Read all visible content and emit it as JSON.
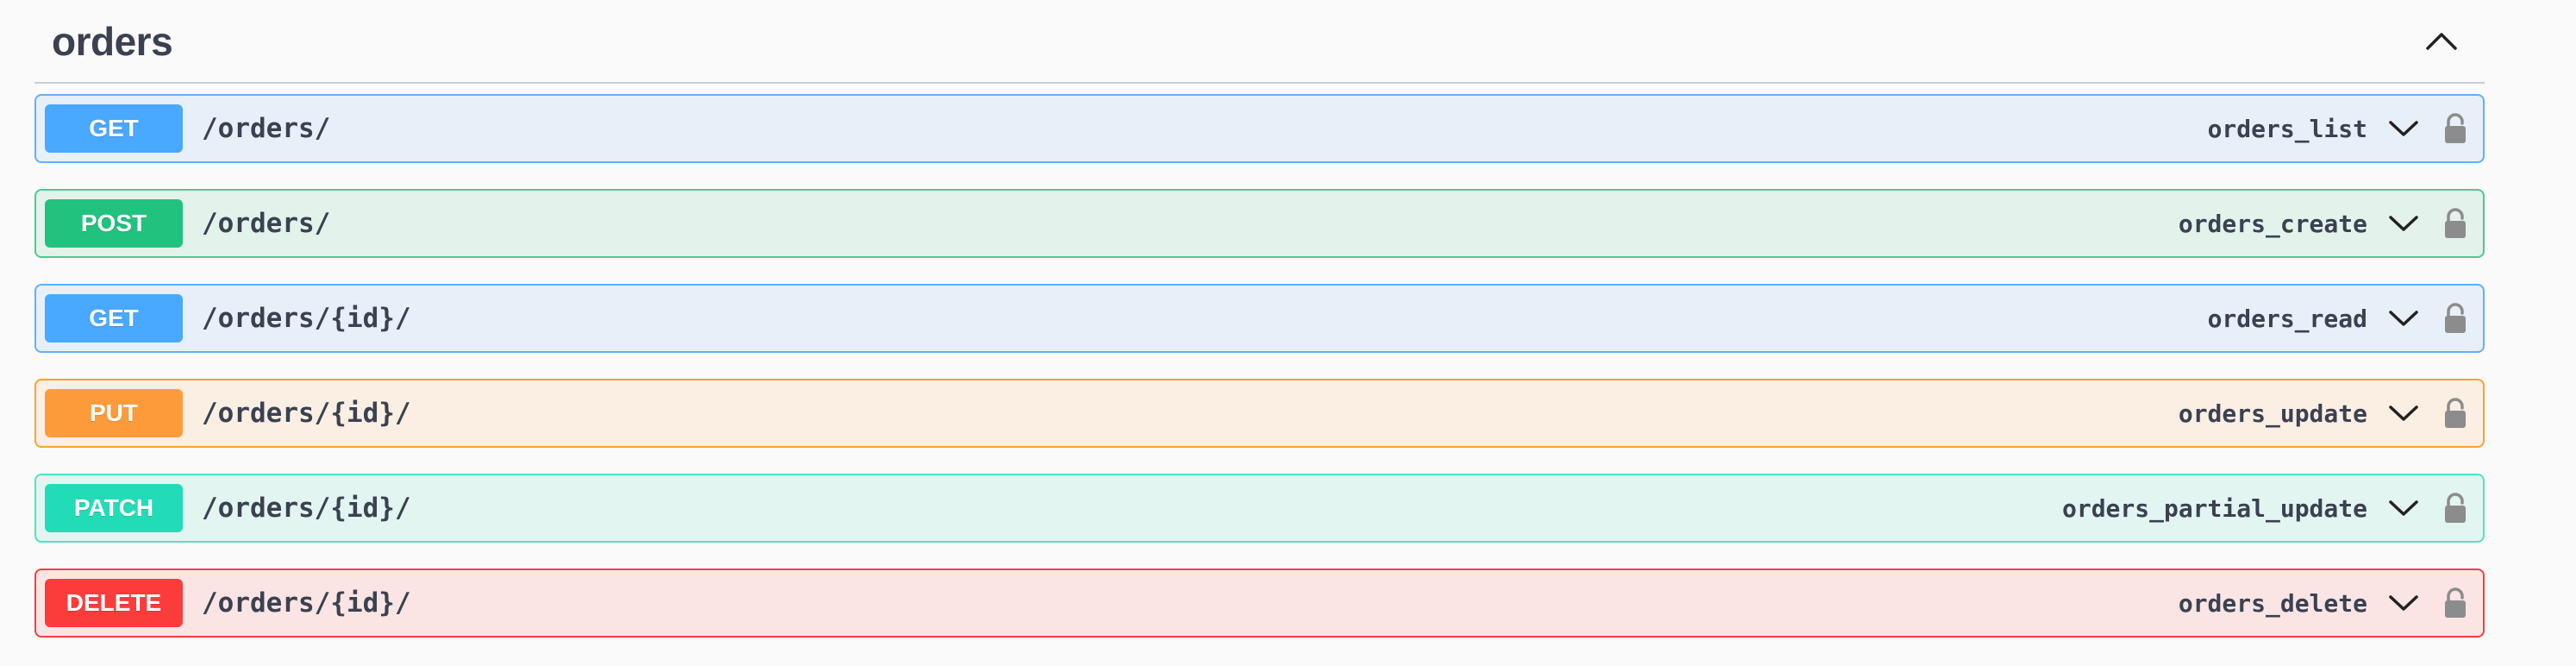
{
  "tag": {
    "title": "orders"
  },
  "operations": [
    {
      "method": "GET",
      "path": "/orders/",
      "operation_id": "orders_list",
      "color": "#49a8ff",
      "bg": "#e7f0f8",
      "border": "#61affe"
    },
    {
      "method": "POST",
      "path": "/orders/",
      "operation_id": "orders_create",
      "color": "#21c27e",
      "bg": "#e3f3ec",
      "border": "#49cc90"
    },
    {
      "method": "GET",
      "path": "/orders/{id}/",
      "operation_id": "orders_read",
      "color": "#49a8ff",
      "bg": "#e7f0f8",
      "border": "#61affe"
    },
    {
      "method": "PUT",
      "path": "/orders/{id}/",
      "operation_id": "orders_update",
      "color": "#fd9b3b",
      "bg": "#fbefe4",
      "border": "#fca130"
    },
    {
      "method": "PATCH",
      "path": "/orders/{id}/",
      "operation_id": "orders_partial_update",
      "color": "#22dcb8",
      "bg": "#e2f5f1",
      "border": "#50e3c2"
    },
    {
      "method": "DELETE",
      "path": "/orders/{id}/",
      "operation_id": "orders_delete",
      "color": "#fc3c3b",
      "bg": "#fae5e4",
      "border": "#f93e3e"
    }
  ],
  "icons": {
    "collapse": "chevron-up-icon",
    "expand": "chevron-down-icon",
    "auth": "lock-icon"
  }
}
